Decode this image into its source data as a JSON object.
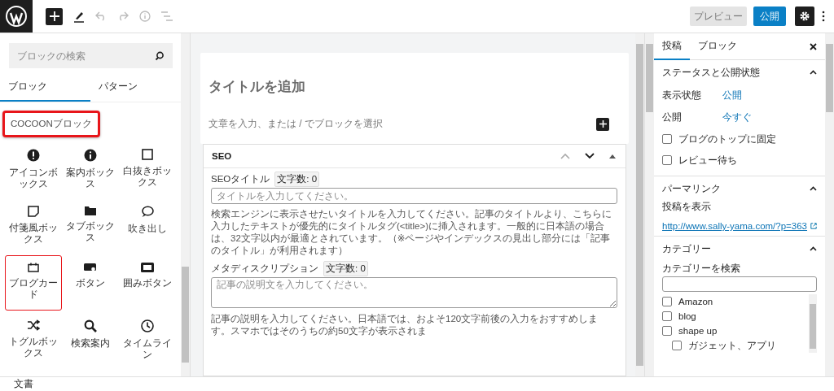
{
  "toolbar": {
    "preview_button": "プレビュー",
    "publish_button": "公開"
  },
  "inserter": {
    "search": {
      "placeholder": "ブロックの検索"
    },
    "tabs": [
      {
        "label": "ブロック",
        "selected": true
      },
      {
        "label": "パターン",
        "selected": false
      }
    ],
    "category": {
      "label": "COCOONブロック",
      "highlighted": true
    },
    "blocks": [
      {
        "label": "アイコンボックス",
        "kind": "alert",
        "highlighted": false
      },
      {
        "label": "案内ボックス",
        "kind": "info",
        "highlighted": false
      },
      {
        "label": "白抜きボックス",
        "kind": "square",
        "highlighted": false
      },
      {
        "label": "付箋風ボックス",
        "kind": "note",
        "highlighted": false
      },
      {
        "label": "タブボックス",
        "kind": "folder",
        "highlighted": false
      },
      {
        "label": "吹き出し",
        "kind": "speech",
        "highlighted": false
      },
      {
        "label": "ブログカード",
        "kind": "card",
        "highlighted": true
      },
      {
        "label": "ボタン",
        "kind": "button",
        "highlighted": false
      },
      {
        "label": "囲みボタン",
        "kind": "wrapbutton",
        "highlighted": false
      },
      {
        "label": "トグルボックス",
        "kind": "shuffle",
        "highlighted": false
      },
      {
        "label": "検索案内",
        "kind": "search",
        "highlighted": false
      },
      {
        "label": "タイムライン",
        "kind": "clock",
        "highlighted": false
      }
    ]
  },
  "editor": {
    "title_placeholder": "タイトルを追加",
    "paragraph_placeholder": "文章を入力、または / でブロックを選択"
  },
  "seo": {
    "title": "SEO",
    "seo_title": {
      "label": "SEOタイトル",
      "count": "文字数: 0",
      "placeholder": "タイトルを入力してください。",
      "help": "検索エンジンに表示させたいタイトルを入力してください。記事のタイトルより、こちらに入力したテキストが優先的にタイトルタグ(<title>)に挿入されます。一般的に日本語の場合は、32文字以内が最適とされています。（※ページやインデックスの見出し部分には「記事のタイトル」が利用されます）"
    },
    "meta_description": {
      "label": "メタディスクリプション",
      "count": "文字数: 0",
      "placeholder": "記事の説明文を入力してください。",
      "help": "記事の説明を入力してください。日本語では、およそ120文字前後の入力をおすすめします。スマホではそのうちの約50文字が表示されま"
    }
  },
  "settings": {
    "tabs": [
      {
        "label": "投稿",
        "selected": true
      },
      {
        "label": "ブロック",
        "selected": false
      }
    ],
    "status": {
      "title": "ステータスと公開状態",
      "rows": [
        {
          "label": "表示状態",
          "value": "公開"
        },
        {
          "label": "公開",
          "value": "今すぐ"
        }
      ],
      "checkboxes": [
        {
          "label": "ブログのトップに固定",
          "checked": false
        },
        {
          "label": "レビュー待ち",
          "checked": false
        }
      ]
    },
    "permalink": {
      "title": "パーマリンク",
      "label": "投稿を表示",
      "url": "http://www.sally-yama.com/?p=363"
    },
    "categories": {
      "title": "カテゴリー",
      "search_label": "カテゴリーを検索",
      "items": [
        {
          "label": "Amazon",
          "checked": false
        },
        {
          "label": "blog",
          "checked": false
        },
        {
          "label": "shape up",
          "checked": false,
          "children": [
            {
              "label": "ガジェット、アプリ",
              "checked": false
            }
          ]
        }
      ]
    }
  },
  "status_bar": {
    "label": "文書"
  }
}
